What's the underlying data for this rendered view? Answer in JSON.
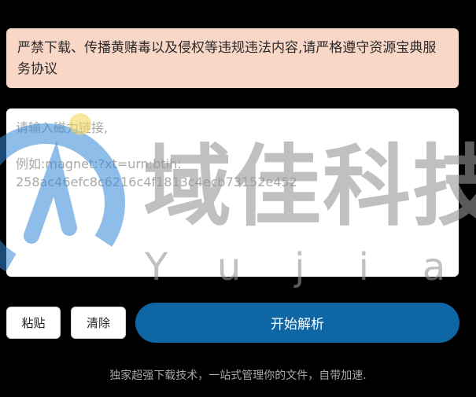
{
  "notice": {
    "text": "严禁下载、传播黄赌毒以及侵权等违规违法内容,请严格遵守资源宝典服务协议"
  },
  "magnet_input": {
    "value": "",
    "placeholder": "请输入磁力链接,\n\n例如:magnet:?xt=urn:btih:\n258ac46efc8c6216c4f1813c4ecb73152e452"
  },
  "actions": {
    "paste_label": "粘贴",
    "clear_label": "清除",
    "parse_label": "开始解析"
  },
  "footer": {
    "tagline": "独家超强下载技术，一站式管理你的文件，自带加速."
  },
  "watermark": {
    "title": "域佳科技",
    "subtitle": "Yujia"
  },
  "colors": {
    "background": "#000000",
    "notice_bg": "#f9d7c7",
    "primary": "#0e66a5",
    "watermark_blue": "#2f86d6",
    "watermark_gray": "#969696"
  }
}
